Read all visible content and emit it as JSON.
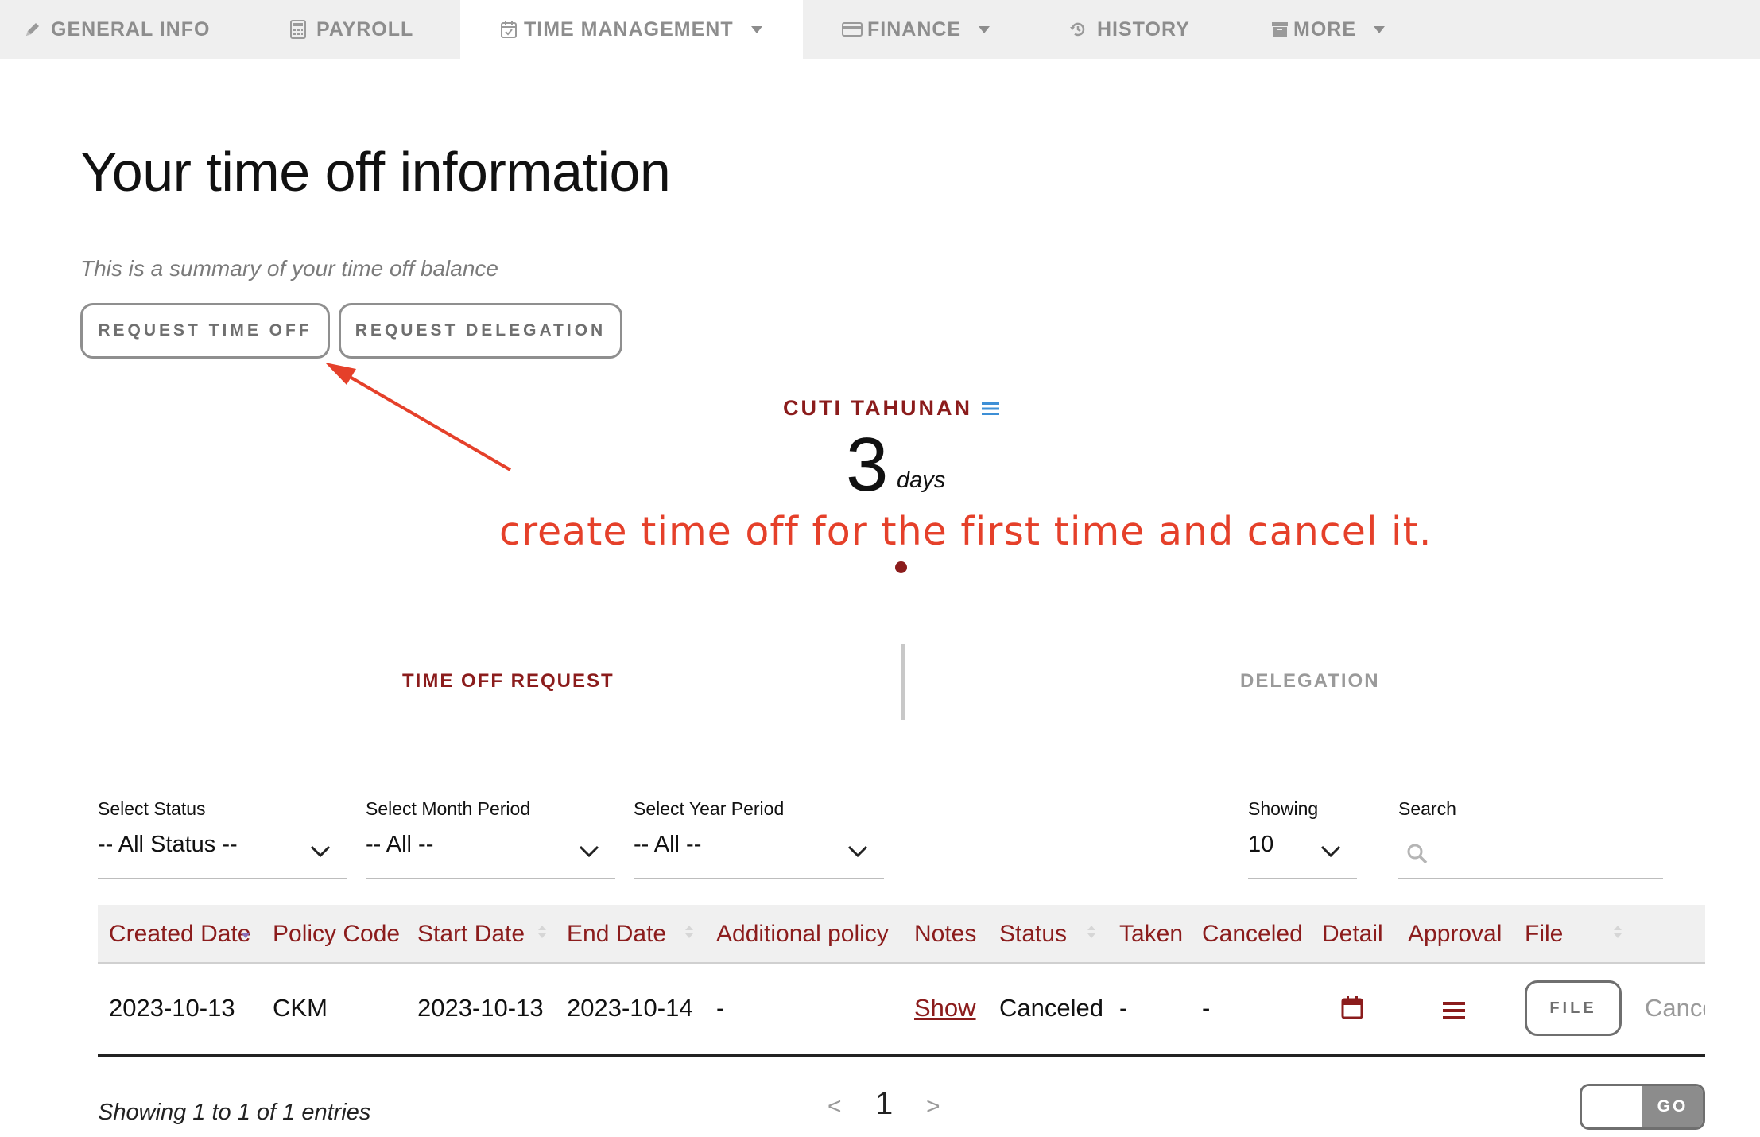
{
  "nav": {
    "tabs": [
      {
        "label": "GENERAL INFO",
        "icon": "pencil-icon"
      },
      {
        "label": "PAYROLL",
        "icon": "calculator-icon"
      },
      {
        "label": "TIME MANAGEMENT",
        "icon": "calendar-check-icon",
        "active": true
      },
      {
        "label": "FINANCE",
        "icon": "credit-card-icon"
      },
      {
        "label": "HISTORY",
        "icon": "history-icon"
      },
      {
        "label": "MORE",
        "icon": "archive-icon"
      }
    ]
  },
  "header": {
    "title": "Your time off information",
    "subtitle": "This is a summary of your time off balance"
  },
  "actions": {
    "request_time_off": "REQUEST TIME OFF",
    "request_delegation": "REQUEST DELEGATION"
  },
  "balance": {
    "policy": "CUTI TAHUNAN",
    "value": "3",
    "unit": "days"
  },
  "annotation": {
    "text": "create time off for the first time and cancel it."
  },
  "subtabs": {
    "time_off_request": "TIME OFF REQUEST",
    "delegation": "DELEGATION"
  },
  "filters": {
    "status": {
      "label": "Select Status",
      "value": "-- All Status --"
    },
    "month": {
      "label": "Select Month Period",
      "value": "-- All --"
    },
    "year": {
      "label": "Select Year Period",
      "value": "-- All --"
    },
    "showing": {
      "label": "Showing",
      "value": "10"
    },
    "search": {
      "label": "Search",
      "placeholder": ""
    }
  },
  "table": {
    "columns": [
      "Created Date",
      "Policy Code",
      "Start Date",
      "End Date",
      "Additional policy",
      "Notes",
      "Status",
      "Taken",
      "Canceled",
      "Detail",
      "Approval",
      "File"
    ],
    "rows": [
      {
        "created_date": "2023-10-13",
        "policy_code": "CKM",
        "start_date": "2023-10-13",
        "end_date": "2023-10-14",
        "additional_policy": "-",
        "notes": "Show",
        "status": "Canceled",
        "taken": "-",
        "canceled": "-",
        "file_button": "FILE",
        "cancel_action": "Cancel"
      }
    ]
  },
  "footer": {
    "entries": "Showing 1 to 1 of 1 entries",
    "prev": "<",
    "page": "1",
    "next": ">",
    "go": "GO"
  },
  "colors": {
    "accent": "#8b1c1c",
    "annotation": "#e5402a",
    "menu_icon": "#3d8fd6",
    "nav_bg": "#efefef"
  }
}
